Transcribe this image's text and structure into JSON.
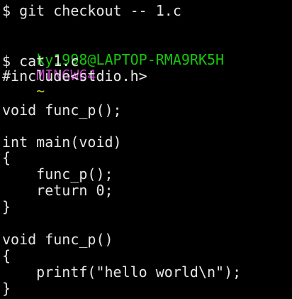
{
  "terminal": {
    "lines": [
      {
        "text": "$ git checkout -- 1.c"
      },
      {
        "text": ""
      },
      {
        "prompt": {
          "user_host": "ky1998@LAPTOP-RMA9RK5H",
          "env": "MINGW64",
          "tilde": "~"
        }
      },
      {
        "text": "$ cat 1.c"
      },
      {
        "text": "#include<stdio.h>"
      },
      {
        "text": ""
      },
      {
        "text": "void func_p();"
      },
      {
        "text": ""
      },
      {
        "text": "int main(void)"
      },
      {
        "text": "{"
      },
      {
        "text": "    func_p();"
      },
      {
        "text": "    return 0;"
      },
      {
        "text": "}"
      },
      {
        "text": ""
      },
      {
        "text": "void func_p()"
      },
      {
        "text": "{"
      },
      {
        "text": "    printf(\"hello world\\n\");"
      },
      {
        "text": "}"
      }
    ]
  }
}
